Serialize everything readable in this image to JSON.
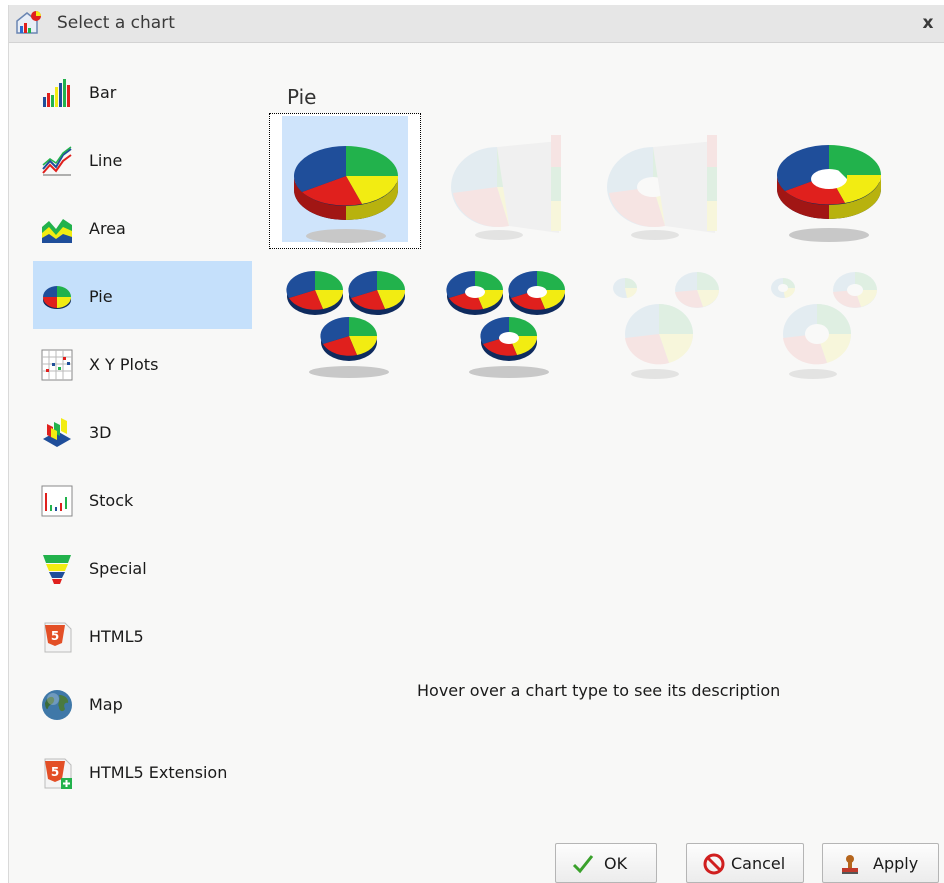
{
  "dialog": {
    "title": "Select a chart",
    "close_label": "x"
  },
  "sidebar": {
    "items": [
      {
        "label": "Bar",
        "icon": "bar-chart-icon"
      },
      {
        "label": "Line",
        "icon": "line-chart-icon"
      },
      {
        "label": "Area",
        "icon": "area-chart-icon"
      },
      {
        "label": "Pie",
        "icon": "pie-chart-icon",
        "selected": true
      },
      {
        "label": "X Y Plots",
        "icon": "xy-plot-icon"
      },
      {
        "label": "3D",
        "icon": "3d-chart-icon"
      },
      {
        "label": "Stock",
        "icon": "stock-chart-icon"
      },
      {
        "label": "Special",
        "icon": "funnel-chart-icon"
      },
      {
        "label": "HTML5",
        "icon": "html5-icon"
      },
      {
        "label": "Map",
        "icon": "globe-icon"
      },
      {
        "label": "HTML5 Extension",
        "icon": "html5-extension-icon"
      }
    ]
  },
  "main": {
    "section_title": "Pie",
    "hover_hint": "Hover over a chart type to see its description",
    "thumbnails": [
      {
        "name": "pie-3d",
        "selected": true,
        "enabled": true
      },
      {
        "name": "pie-bar-breakout",
        "enabled": false
      },
      {
        "name": "ring-bar-breakout",
        "enabled": false
      },
      {
        "name": "ring-3d",
        "enabled": true
      },
      {
        "name": "multi-pie",
        "enabled": true
      },
      {
        "name": "multi-ring",
        "enabled": true
      },
      {
        "name": "proportional-pie",
        "enabled": false
      },
      {
        "name": "proportional-ring",
        "enabled": false
      }
    ]
  },
  "footer": {
    "ok_label": "OK",
    "cancel_label": "Cancel",
    "apply_label": "Apply"
  },
  "colors": {
    "selection": "#c5e0fb",
    "pie_blue": "#1f4e9a",
    "pie_green": "#22b24c",
    "pie_yellow": "#f2ec12",
    "pie_red": "#e0201d"
  }
}
